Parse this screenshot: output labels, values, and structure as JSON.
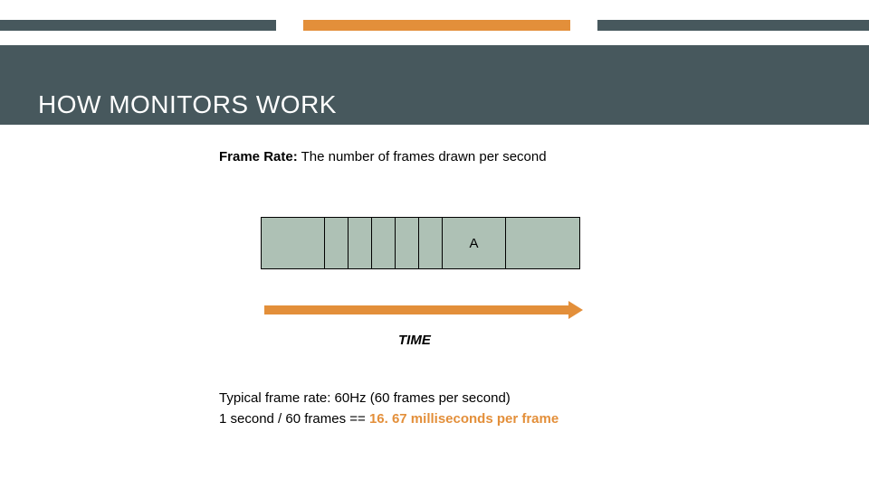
{
  "title": "HOW MONITORS WORK",
  "definition": {
    "label": "Frame Rate:",
    "text": "The number of frames drawn per second"
  },
  "timeline": {
    "a_label": "A",
    "time_label": "TIME"
  },
  "typical": {
    "line1": "Typical frame rate: 60Hz (60 frames per second)",
    "line2_prefix": " 1 second / 60 frames == ",
    "line2_highlight": "16. 67 milliseconds per frame"
  },
  "colors": {
    "dark": "#47585d",
    "orange": "#e38f3a",
    "box": "#aec1b5"
  }
}
